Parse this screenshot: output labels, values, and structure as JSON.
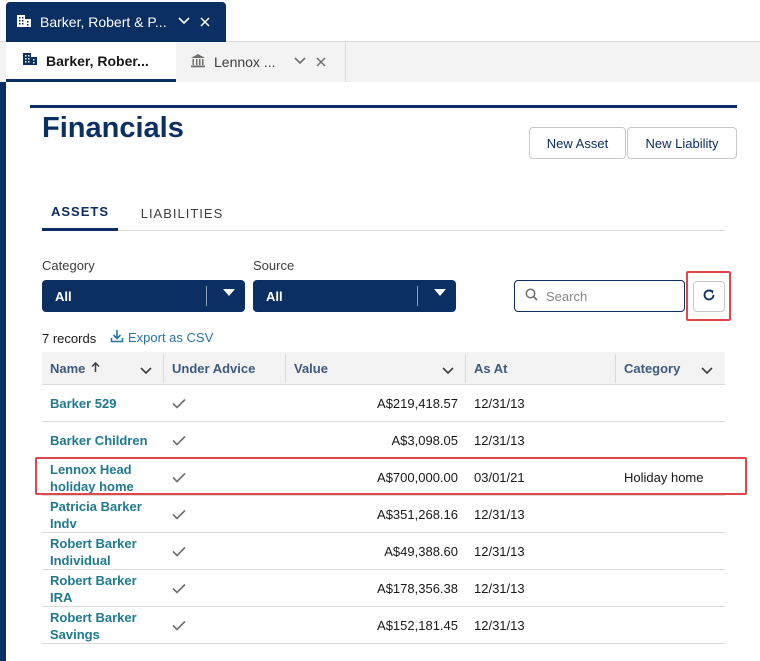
{
  "workspace_tab": {
    "label": "Barker, Robert & P...",
    "icon": "building-icon"
  },
  "subtabs": [
    {
      "label": "Barker, Rober...",
      "icon": "building-icon"
    },
    {
      "label": "Lennox ...",
      "icon": "bank-icon"
    }
  ],
  "page": {
    "title": "Financials",
    "new_asset_label": "New Asset",
    "new_liability_label": "New Liability"
  },
  "tabs": {
    "assets": "ASSETS",
    "liabilities": "LIABILITIES"
  },
  "filters": {
    "category_label": "Category",
    "category_value": "All",
    "source_label": "Source",
    "source_value": "All"
  },
  "search": {
    "placeholder": "Search"
  },
  "records_count": "7 records",
  "export_label": "Export as CSV",
  "columns": {
    "name": "Name",
    "under_advice": "Under Advice",
    "value": "Value",
    "as_at": "As At",
    "category": "Category"
  },
  "rows": [
    {
      "name": "Barker 529",
      "value": "A$219,418.57",
      "as_at": "12/31/13",
      "category": ""
    },
    {
      "name": "Barker Children",
      "value": "A$3,098.05",
      "as_at": "12/31/13",
      "category": ""
    },
    {
      "name": "Lennox Head holiday home",
      "value": "A$700,000.00",
      "as_at": "03/01/21",
      "category": "Holiday home"
    },
    {
      "name": "Patricia Barker Indv",
      "value": "A$351,268.16",
      "as_at": "12/31/13",
      "category": ""
    },
    {
      "name": "Robert Barker Individual",
      "value": "A$49,388.60",
      "as_at": "12/31/13",
      "category": ""
    },
    {
      "name": "Robert Barker IRA",
      "value": "A$178,356.38",
      "as_at": "12/31/13",
      "category": ""
    },
    {
      "name": "Robert Barker Savings",
      "value": "A$152,181.45",
      "as_at": "12/31/13",
      "category": ""
    }
  ],
  "colors": {
    "navy": "#0b2e63",
    "link": "#207a8f",
    "highlight": "#e0474c"
  }
}
